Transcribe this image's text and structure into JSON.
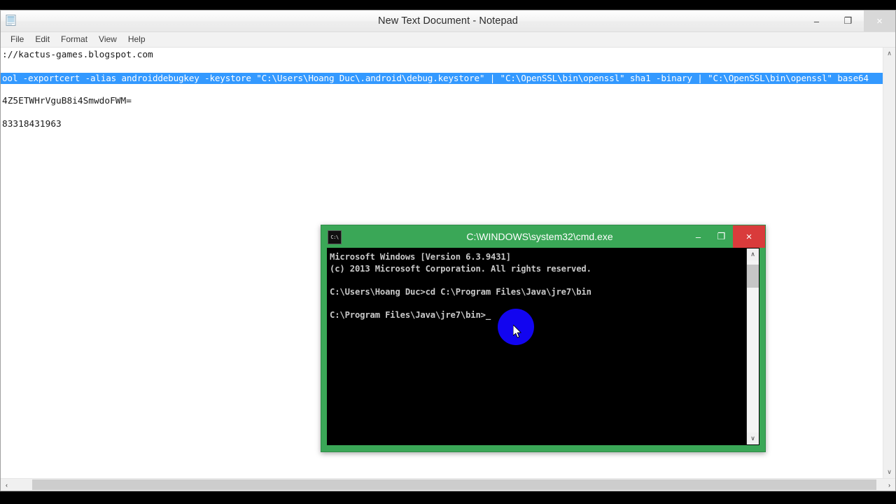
{
  "notepad": {
    "title": "New Text Document - Notepad",
    "app_icon": "notepad-icon",
    "menu": [
      {
        "label": "File"
      },
      {
        "label": "Edit"
      },
      {
        "label": "Format"
      },
      {
        "label": "View"
      },
      {
        "label": "Help"
      }
    ],
    "window_controls": {
      "minimize": "–",
      "maximize": "❐",
      "close": "×"
    },
    "lines": [
      {
        "text": "://kactus-games.blogspot.com",
        "selected": false
      },
      {
        "text": "",
        "selected": false,
        "blank": true
      },
      {
        "text": "ool -exportcert -alias androiddebugkey -keystore \"C:\\Users\\Hoang Duc\\.android\\debug.keystore\" | \"C:\\OpenSSL\\bin\\openssl\" sha1 -binary | \"C:\\OpenSSL\\bin\\openssl\" base64",
        "selected": true
      },
      {
        "text": "",
        "selected": false,
        "blank": true
      },
      {
        "text": "4Z5ETWHrVguB8i4SmwdoFWM=",
        "selected": false
      },
      {
        "text": "",
        "selected": false,
        "blank": true
      },
      {
        "text": "83318431963",
        "selected": false
      }
    ],
    "scrollbar": {
      "up_arrow": "∧",
      "down_arrow": "∨",
      "left_arrow": "‹",
      "right_arrow": "›"
    }
  },
  "cmd": {
    "title": "C:\\WINDOWS\\system32\\cmd.exe",
    "app_icon": "cmd-console-icon",
    "icon_text": "C:\\",
    "window_controls": {
      "minimize": "–",
      "maximize": "❐",
      "close": "×"
    },
    "lines": [
      {
        "text": "Microsoft Windows [Version 6.3.9431]"
      },
      {
        "text": "(c) 2013 Microsoft Corporation. All rights reserved."
      },
      {
        "text": "",
        "blank": true
      },
      {
        "text": "C:\\Users\\Hoang Duc>cd C:\\Program Files\\Java\\jre7\\bin"
      },
      {
        "text": "",
        "blank": true
      },
      {
        "text": "C:\\Program Files\\Java\\jre7\\bin>_"
      }
    ],
    "scrollbar": {
      "up_arrow": "∧",
      "down_arrow": "∨"
    }
  },
  "colors": {
    "cmd_frame_green": "#3aa757",
    "cmd_close_red": "#d93b3b",
    "notepad_selection_blue": "#3399ff",
    "click_highlight_blue": "#1205f0",
    "console_background": "#000000",
    "console_text": "#c8c8c8"
  },
  "cursor": {
    "click_highlight": "blue-circle-click-indicator",
    "pointer": "arrow-cursor"
  }
}
